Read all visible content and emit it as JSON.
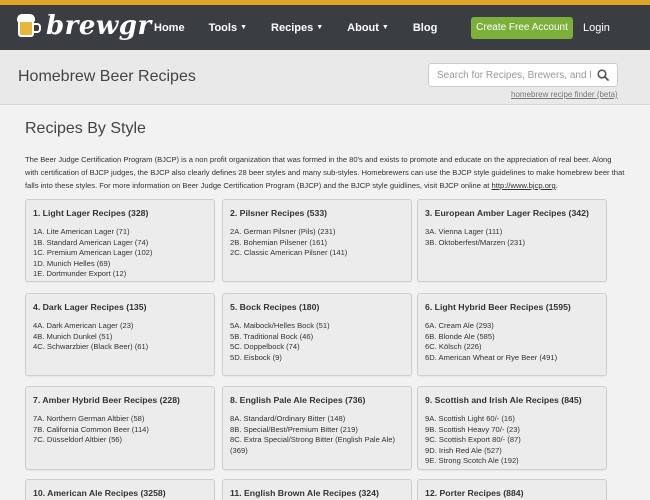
{
  "nav": {
    "logo": "brewgr",
    "links": [
      "Home",
      "Tools",
      "Recipes",
      "About",
      "Blog"
    ],
    "dropdowns": [
      false,
      true,
      true,
      true,
      false
    ],
    "cta": "Create Free Account",
    "login": "Login",
    "colors": {
      "bar": "#3a3d42",
      "stripe": "#e0a526",
      "cta": "#7cb03b"
    }
  },
  "subheader": {
    "title": "Homebrew Beer Recipes",
    "search_placeholder": "Search for Recipes, Brewers, and More",
    "finder_link": "homebrew recipe finder (beta)"
  },
  "main": {
    "title": "Recipes By Style",
    "intro": "The Beer Judge Certification Program (BJCP) is a non profit organization that was formed in the 80's and exists to promote and educate on the appreciation of real beer. Along with certification of BJCP judges, the BJCP also clearly defines 28 beer styles and many sub-styles. Homebrewers can use the BJCP style guidelines to make homebrew beer that falls into these styles. For more information on Beer Judge Certification Program (BJCP) and the BJCP style guidlines, visit BJCP online at ",
    "intro_url": "http://www.bjcp.org",
    "intro_end": "."
  },
  "categories": [
    {
      "title": "1. Light Lager Recipes (328)",
      "items": [
        "1A. Lite American Lager (71)",
        "1B. Standard American Lager (74)",
        "1C. Premium American Lager (102)",
        "1D. Munich Helles (69)",
        "1E. Dortmunder Export (12)"
      ]
    },
    {
      "title": "2. Pilsner Recipes (533)",
      "items": [
        "2A. German Pilsner (Pils) (231)",
        "2B. Bohemian Pilsener (161)",
        "2C. Classic American Pilsner (141)"
      ]
    },
    {
      "title": "3. European Amber Lager Recipes (342)",
      "items": [
        "3A. Vienna Lager (111)",
        "3B. Oktoberfest/Marzen (231)"
      ]
    },
    {
      "title": "4. Dark Lager Recipes (135)",
      "items": [
        "4A. Dark American Lager (23)",
        "4B. Munich Dunkel (51)",
        "4C. Schwarzbier (Black Beer) (61)"
      ]
    },
    {
      "title": "5. Bock Recipes (180)",
      "items": [
        "5A. Maibock/Helles Bock (51)",
        "5B. Traditional Bock (46)",
        "5C. Doppelbock (74)",
        "5D. Eisbock (9)"
      ]
    },
    {
      "title": "6. Light Hybrid Beer Recipes (1595)",
      "items": [
        "6A. Cream Ale (293)",
        "6B. Blonde Ale (585)",
        "6C. Kölsch (226)",
        "6D. American Wheat or Rye Beer (491)"
      ]
    },
    {
      "title": "7. Amber Hybrid Beer Recipes (228)",
      "items": [
        "7A. Northern German Altbier (58)",
        "7B. California Common Beer (114)",
        "7C. Düsseldorf Altbier (56)"
      ]
    },
    {
      "title": "8. English Pale Ale Recipes (736)",
      "items": [
        "8A. Standard/Ordinary Bitter (148)",
        "8B. Special/Best/Premium Bitter (219)",
        "8C. Extra Special/Strong Bitter (English Pale Ale) (369)"
      ]
    },
    {
      "title": "9. Scottish and Irish Ale Recipes (845)",
      "items": [
        "9A. Scottish Light 60/- (16)",
        "9B. Scottish Heavy 70/- (23)",
        "9C. Scottish Export 80/- (87)",
        "9D. Irish Red Ale (527)",
        "9E. Strong Scotch Ale (192)"
      ]
    },
    {
      "title": "10. American Ale Recipes (3258)",
      "items": []
    },
    {
      "title": "11. English Brown Ale Recipes (324)",
      "items": []
    },
    {
      "title": "12. Porter Recipes (884)",
      "items": []
    }
  ]
}
